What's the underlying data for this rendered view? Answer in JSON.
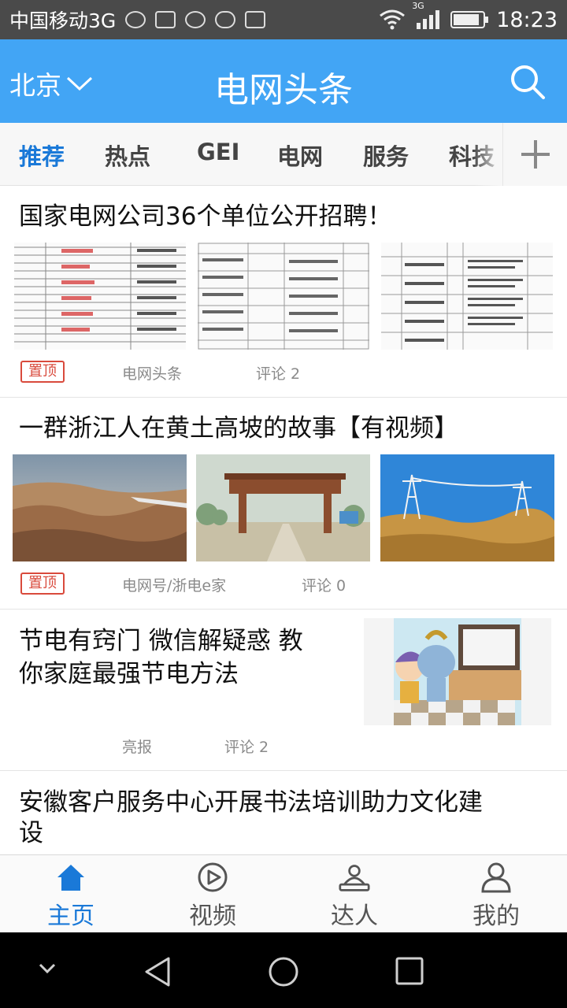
{
  "status_bar": {
    "carrier": "中国移动3G",
    "network_label": "3G",
    "battery_level": 0.9,
    "time": "18:23",
    "notification_icons": [
      "weather-icon",
      "image-icon",
      "app-icon",
      "cloud-icon",
      "keyboard-icon"
    ]
  },
  "header": {
    "city": "北京",
    "title": "电网头条"
  },
  "tabs": [
    "推荐",
    "热点",
    "GEI",
    "电网",
    "服务",
    "科技"
  ],
  "articles": [
    {
      "title": "国家电网公司36个单位公开招聘！",
      "badge": "置顶",
      "source": "电网头条",
      "comments": "评论 2",
      "thumbs": [
        "document-table",
        "document-table",
        "document-table"
      ]
    },
    {
      "title": "一群浙江人在黄土高坡的故事【有视频】",
      "badge": "置顶",
      "source": "电网号/浙电e家",
      "comments": "评论 0",
      "thumbs": [
        "aerial-mountains",
        "village-gate",
        "power-tower"
      ]
    },
    {
      "title_line1": "节电有窍门 微信解疑惑 教",
      "title_line2": "你家庭最强节电方法",
      "source": "亮报",
      "comments": "评论 2",
      "thumbs": [
        "cartoon-tv"
      ]
    },
    {
      "title_line1": "安徽客户服务中心开展书法培训助力文化建",
      "title_line2": "设"
    }
  ],
  "bottom_nav": [
    {
      "label": "主页",
      "icon": "home-icon",
      "active": true
    },
    {
      "label": "视频",
      "icon": "video-icon",
      "active": false
    },
    {
      "label": "达人",
      "icon": "expert-icon",
      "active": false
    },
    {
      "label": "我的",
      "icon": "user-icon",
      "active": false
    }
  ],
  "colors": {
    "status_bar": "#4a4a4a",
    "header": "#42a5f5",
    "active_tab": "#1a79d8",
    "badge": "#d94a3c"
  }
}
